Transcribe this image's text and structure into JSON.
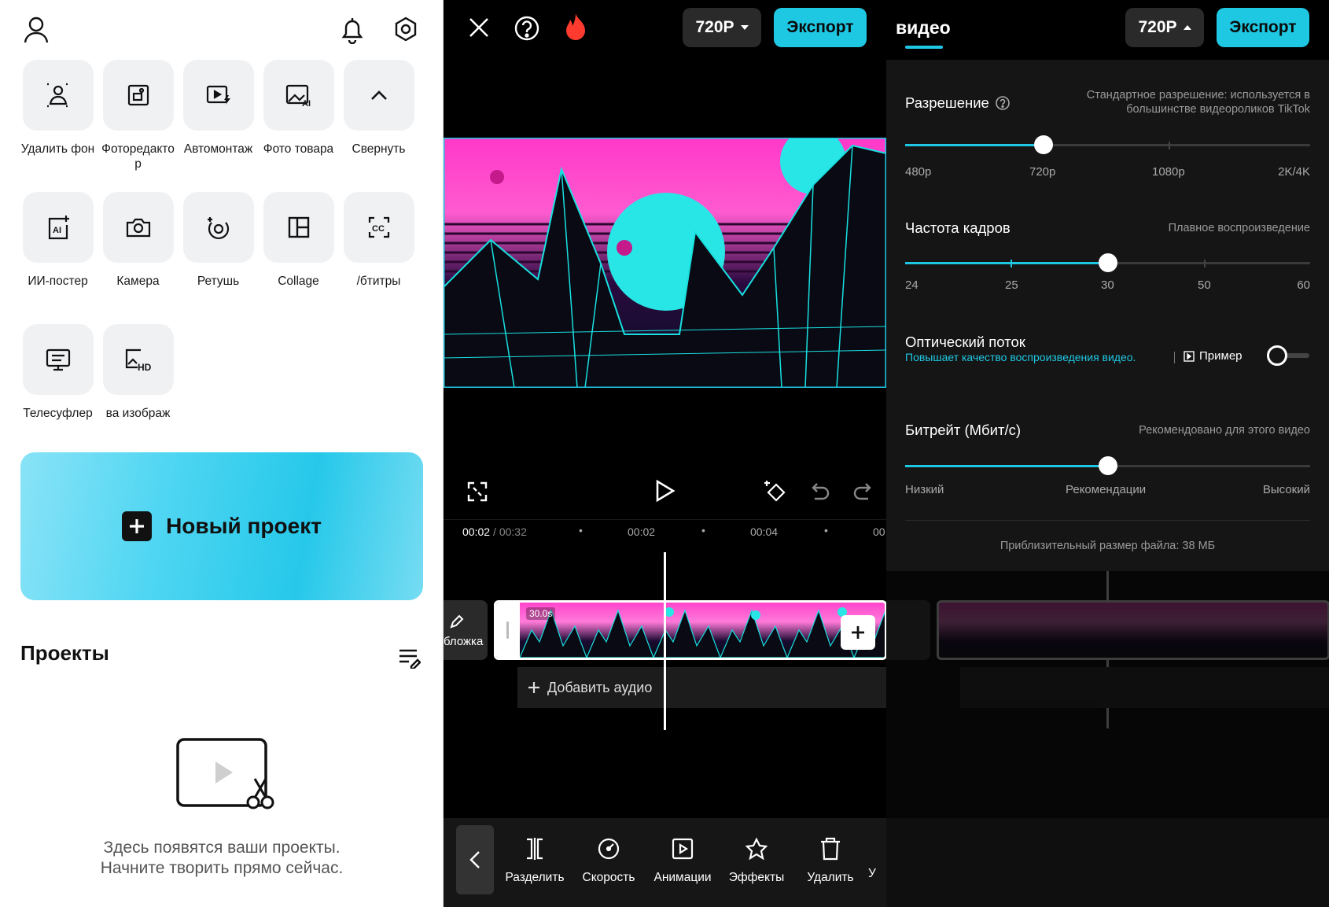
{
  "home": {
    "tiles": [
      {
        "label": "Удалить фон",
        "icon": "remove-background-icon"
      },
      {
        "label": "Фоторедакто р",
        "icon": "photo-editor-icon"
      },
      {
        "label": "Автомонтаж",
        "icon": "auto-edit-icon"
      },
      {
        "label": "Фото товара",
        "icon": "product-photo-icon"
      },
      {
        "label": "Свернуть",
        "icon": "chevron-up-icon"
      },
      {
        "label": "ИИ-постер",
        "icon": "ai-poster-icon"
      },
      {
        "label": "Камера",
        "icon": "camera-icon"
      },
      {
        "label": "Ретушь",
        "icon": "retouch-icon"
      },
      {
        "label": "Collage",
        "icon": "collage-icon"
      },
      {
        "label": "/бтитры",
        "icon": "captions-icon"
      },
      {
        "label": "Телесуфлер",
        "icon": "teleprompter-icon"
      },
      {
        "label": "ва изображ",
        "icon": "hd-image-icon"
      }
    ],
    "new_project_label": "Новый проект",
    "projects_title": "Проекты",
    "empty_line1": "Здесь появятся ваши проекты.",
    "empty_line2": "Начните творить прямо сейчас."
  },
  "editor": {
    "resolution_label": "720P",
    "export_label": "Экспорт",
    "time_current": "00:02",
    "time_total": "/ 00:32",
    "ruler_marks": [
      "00:02",
      "00:04",
      "00"
    ],
    "clip_duration": "30.0s",
    "cover_label": "бложка",
    "add_audio_label": "Добавить аудио",
    "tools": [
      {
        "label": "Разделить",
        "icon": "split-icon"
      },
      {
        "label": "Скорость",
        "icon": "speed-icon"
      },
      {
        "label": "Анимации",
        "icon": "animation-icon"
      },
      {
        "label": "Эффекты",
        "icon": "effects-icon"
      },
      {
        "label": "Удалить",
        "icon": "delete-icon"
      },
      {
        "label": "У",
        "icon": ""
      }
    ]
  },
  "export_settings": {
    "tab_label": "видео",
    "resolution_label": "720P",
    "export_label": "Экспорт",
    "resolution": {
      "label": "Разрешение",
      "hint_line1": "Стандартное разрешение: используется в",
      "hint_line2": "большинстве видеороликов TikTok",
      "options": [
        "480p",
        "720p",
        "1080p",
        "2K/4K"
      ],
      "selected": "720p"
    },
    "frame_rate": {
      "label": "Частота кадров",
      "hint": "Плавное воспроизведение",
      "options": [
        "24",
        "25",
        "30",
        "50",
        "60"
      ],
      "selected": "30"
    },
    "optical_flow": {
      "label": "Оптический поток",
      "description": "Повышает качество воспроизведения видео.",
      "example_label": "Пример",
      "enabled": false
    },
    "bitrate": {
      "label": "Битрейт (Мбит/с)",
      "hint": "Рекомендовано для этого видео",
      "options": [
        "Низкий",
        "Рекомендации",
        "Высокий"
      ],
      "selected": "Рекомендации"
    },
    "file_size": "Приблизительный размер файла: 38 МБ"
  },
  "colors": {
    "accent": "#1ec8e3",
    "neon_pink": "#ff38c8",
    "dark_bg": "#000000"
  }
}
